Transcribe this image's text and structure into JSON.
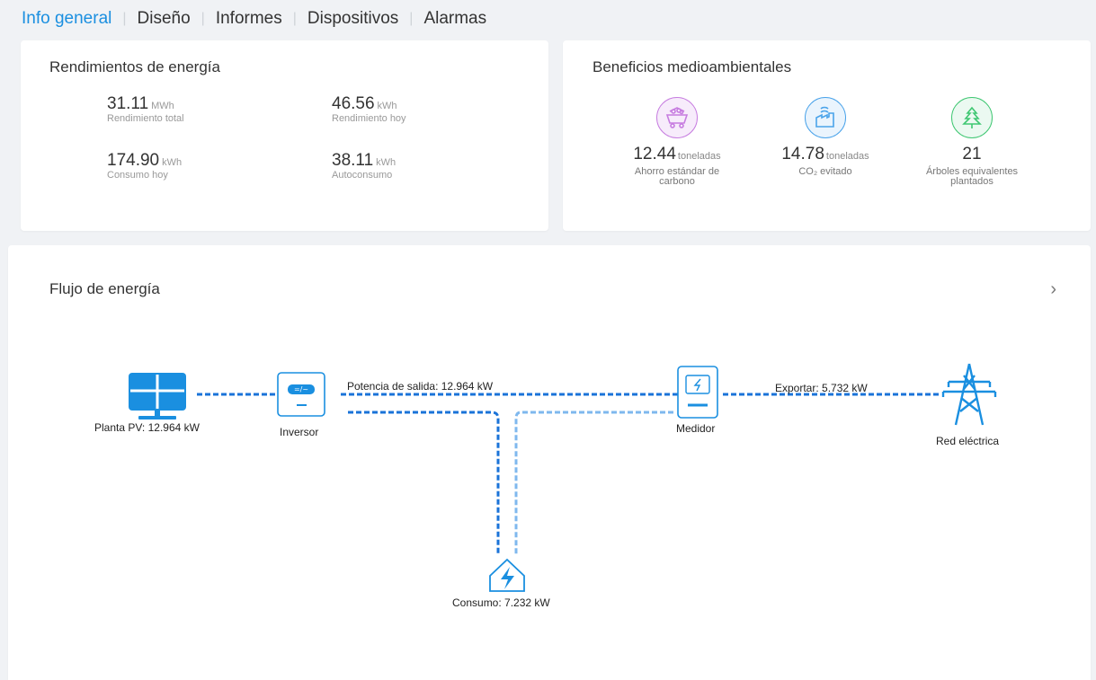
{
  "tabs": [
    "Info general",
    "Diseño",
    "Informes",
    "Dispositivos",
    "Alarmas"
  ],
  "energy_yields": {
    "title": "Rendimientos de energía",
    "items": [
      {
        "value": "31.11",
        "unit": "MWh",
        "label": "Rendimiento total"
      },
      {
        "value": "46.56",
        "unit": "kWh",
        "label": "Rendimiento hoy"
      },
      {
        "value": "174.90",
        "unit": "kWh",
        "label": "Consumo hoy"
      },
      {
        "value": "38.11",
        "unit": "kWh",
        "label": "Autoconsumo"
      }
    ]
  },
  "environmental": {
    "title": "Beneficios medioambientales",
    "items": [
      {
        "value": "12.44",
        "unit": "toneladas",
        "label_line1": "Ahorro estándar de",
        "label_line2": "carbono",
        "icon": "coal-cart-icon",
        "color": "#c77de0"
      },
      {
        "value": "14.78",
        "unit": "toneladas",
        "label_line1": "CO₂ evitado",
        "label_line2": "",
        "icon": "factory-icon",
        "color": "#4aa3ea"
      },
      {
        "value": "21",
        "unit": "",
        "label_line1": "Árboles equivalentes",
        "label_line2": "plantados",
        "icon": "tree-icon",
        "color": "#3fc772"
      }
    ]
  },
  "energy_flow": {
    "title": "Flujo de energía",
    "pv_label": "Planta PV: 12.964 kW",
    "inverter_label": "Inversor",
    "output_power_label": "Potencia de salida: 12.964 kW",
    "meter_label": "Medidor",
    "export_label": "Exportar: 5.732 kW",
    "grid_label": "Red eléctrica",
    "consumption_label": "Consumo: 7.232 kW",
    "line_color": "#1a73d8",
    "light_line_color": "#7fb8ee"
  }
}
